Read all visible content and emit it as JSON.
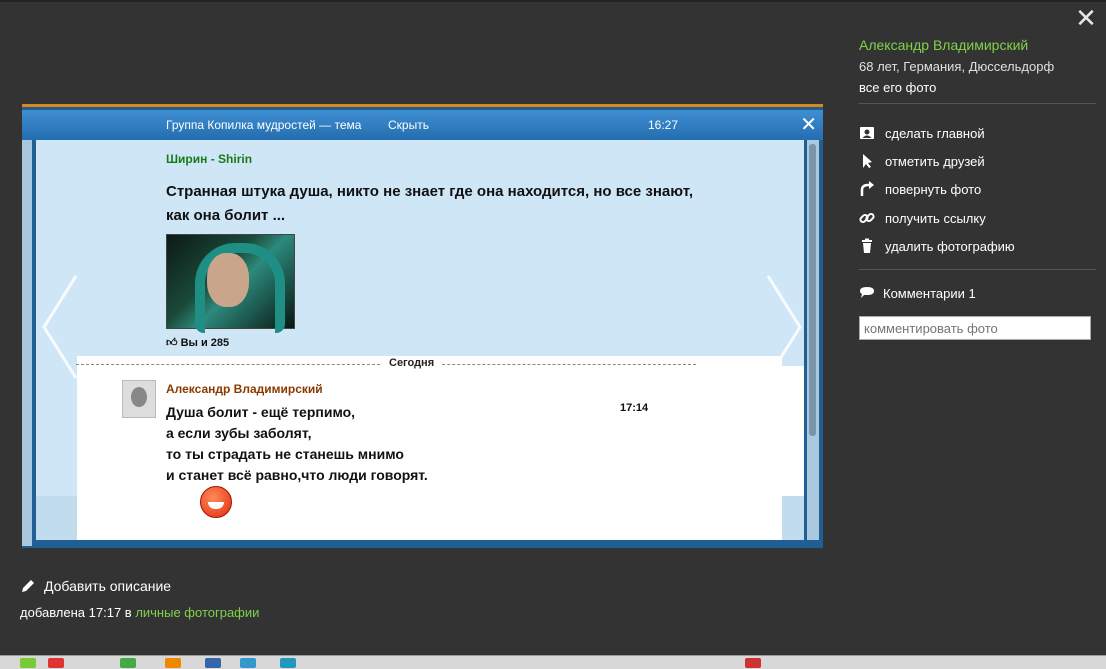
{
  "viewer": {
    "close_icon": "close-icon"
  },
  "photo": {
    "chat_header": {
      "title": "Группа Копилка мудростей — тема",
      "hide": "Скрыть",
      "time": "16:27"
    },
    "message1": {
      "sender": "Ширин - Shirin",
      "text": "Странная штука душа, никто не знает где она находится, но все знают, как она болит ...",
      "likes": "Вы и 285"
    },
    "divider": "Сегодня",
    "message2": {
      "sender": "Александр Владимирский",
      "time": "17:14",
      "lines": [
        "Душа болит - ещё терпимо,",
        "а если зубы заболят,",
        "то ты страдать не станешь мнимо",
        "и станет всё равно,что люди говорят."
      ]
    }
  },
  "description": {
    "add_label": "Добавить описание",
    "added_prefix": "добавлена 17:17 в",
    "album_link": "личные фотографии"
  },
  "sidebar": {
    "owner_name": "Александр Владимирский",
    "owner_info": "68 лет, Германия, Дюссельдорф",
    "all_photos": "все его фото",
    "actions": [
      {
        "label": "сделать главной",
        "icon": "profile-card-icon"
      },
      {
        "label": "отметить друзей",
        "icon": "cursor-icon"
      },
      {
        "label": "повернуть фото",
        "icon": "rotate-icon"
      },
      {
        "label": "получить ссылку",
        "icon": "link-icon"
      },
      {
        "label": "удалить фотографию",
        "icon": "trash-icon"
      }
    ],
    "comments_label": "Комментарии 1",
    "comment_placeholder": "комментировать фото"
  }
}
